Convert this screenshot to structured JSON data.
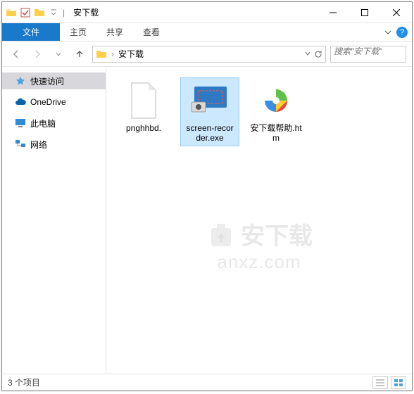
{
  "title": "安下载",
  "ribbon": {
    "file": "文件",
    "tabs": [
      "主页",
      "共享",
      "查看"
    ]
  },
  "nav": {
    "crumb": "安下载",
    "search_placeholder": "搜索\"安下载\""
  },
  "sidebar": {
    "items": [
      {
        "label": "快速访问"
      },
      {
        "label": "OneDrive"
      },
      {
        "label": "此电脑"
      },
      {
        "label": "网络"
      }
    ]
  },
  "files": [
    {
      "label": "pnghhbd."
    },
    {
      "label": "screen-recorder.exe"
    },
    {
      "label": "安下载帮助.htm"
    }
  ],
  "status": "3 个项目",
  "watermark": {
    "text": "安下载",
    "sub": "anxz.com"
  }
}
